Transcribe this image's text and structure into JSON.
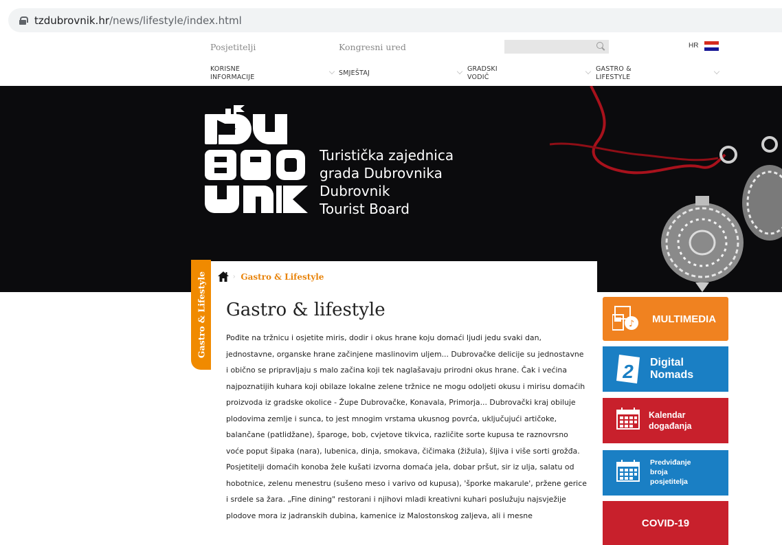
{
  "browser": {
    "url_host": "tzdubrovnik.hr",
    "url_path": "/news/lifestyle/index.html"
  },
  "top_links": {
    "visitors": "Posjetitelji",
    "congress": "Kongresni ured",
    "lang": "HR"
  },
  "nav": {
    "items": [
      {
        "line1": "KORISNE",
        "line2": "INFORMACIJE"
      },
      {
        "line1": "SMJEŠTAJ",
        "line2": ""
      },
      {
        "line1": "GRADSKI",
        "line2": "VODIČ"
      },
      {
        "line1": "GASTRO &",
        "line2": "LIFESTYLE"
      }
    ]
  },
  "hero": {
    "logo_alt": "DUBROVNIK",
    "board_lines": [
      "Turistička zajednica",
      "grada Dubrovnika",
      "Dubrovnik",
      "Tourist Board"
    ]
  },
  "side_tab": "Gastro & Lifestyle",
  "breadcrumb": {
    "current": "Gastro & Lifestyle"
  },
  "page": {
    "title": "Gastro & lifestyle",
    "paragraphs": [
      "Pođite na tržnicu i osjetite miris, dodir i okus hrane koju domaći ljudi jedu svaki dan, jednostavne, organske hrane začinjene maslinovim uljem... Dubrovačke delicije su jednostavne i obično se pripravljaju s malo začina koji tek naglašavaju prirodni okus hrane. Čak i većina najpoznatijih kuhara koji obilaze lokalne zelene tržnice ne mogu odoljeti okusu i mirisu domaćih proizvoda iz gradske okolice - Župe Dubrovačke, Konavala, Primorja... Dubrovački kraj obiluje plodovima zemlje i sunca, to jest mnogim vrstama ukusnog povrća, uključujući artičoke, balančane (patlidžane), šparoge, bob, cvjetove tikvica, različite sorte kupusa te raznovrsno voće poput šipaka (nara), lubenica, dinja, smokava, čičimaka (žižula), šljiva i više sorti grožđa.",
      "Posjetitelji domaćih konoba žele kušati izvorna domaća jela, dobar pršut, sir iz ulja, salatu od hobotnice, zelenu menestru (sušeno meso i varivo od kupusa), 'šporke makarule', pržene gerice i srdele sa žara. „Fine dining\" restorani i njihovi mladi kreativni kuhari poslužuju najsvježije plodove mora iz jadranskih dubina, kamenice iz Malostonskog zaljeva, ali i mesne"
    ]
  },
  "widgets": {
    "multimedia": "MULTIMEDIA",
    "nomads": "Digital Nomads",
    "kalendar": [
      "Kalendar",
      "događanja"
    ],
    "predvid": [
      "Predviđanje",
      "broja",
      "posjetitelja"
    ],
    "covid": "COVID-19"
  },
  "colors": {
    "orange": "#f08220",
    "blue": "#1a7fc4",
    "red": "#c8202c",
    "hero_bg": "#0b0b0d"
  }
}
